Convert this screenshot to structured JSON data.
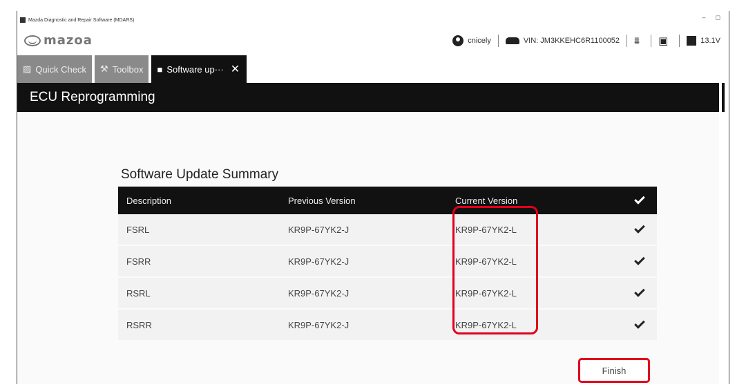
{
  "window": {
    "title": "Mazda Diagnostic and Repair Software (MDARS)",
    "controls": [
      "–",
      "◻"
    ]
  },
  "header": {
    "brand": "mazoa",
    "user": "cnicely",
    "vin": "VIN: JM3KKEHC6R1100052",
    "voltage": "13.1V",
    "icons": [
      "user-icon",
      "car-icon",
      "connection-icon",
      "battery-check-icon",
      "battery-icon"
    ]
  },
  "tabs": [
    {
      "label": "Quick Check",
      "icon": "briefcase-icon"
    },
    {
      "label": "Toolbox",
      "icon": "tools-icon"
    },
    {
      "label": "Software up···",
      "icon": "chip-icon",
      "active": true
    }
  ],
  "page": {
    "section_title": "ECU Reprogramming",
    "summary_title": "Software Update Summary"
  },
  "table": {
    "headers": [
      "Description",
      "Previous Version",
      "Current Version"
    ],
    "rows": [
      {
        "description": "FSRL",
        "previous": "KR9P-67YK2-J",
        "current": "KR9P-67YK2-L",
        "done": true
      },
      {
        "description": "FSRR",
        "previous": "KR9P-67YK2-J",
        "current": "KR9P-67YK2-L",
        "done": true
      },
      {
        "description": "RSRL",
        "previous": "KR9P-67YK2-J",
        "current": "KR9P-67YK2-L",
        "done": true
      },
      {
        "description": "RSRR",
        "previous": "KR9P-67YK2-J",
        "current": "KR9P-67YK2-L",
        "done": true
      }
    ]
  },
  "actions": {
    "finish_label": "Finish"
  },
  "colors": {
    "highlight": "#e0001b",
    "bar": "#111111",
    "tab_inactive": "#8a8a8a"
  }
}
